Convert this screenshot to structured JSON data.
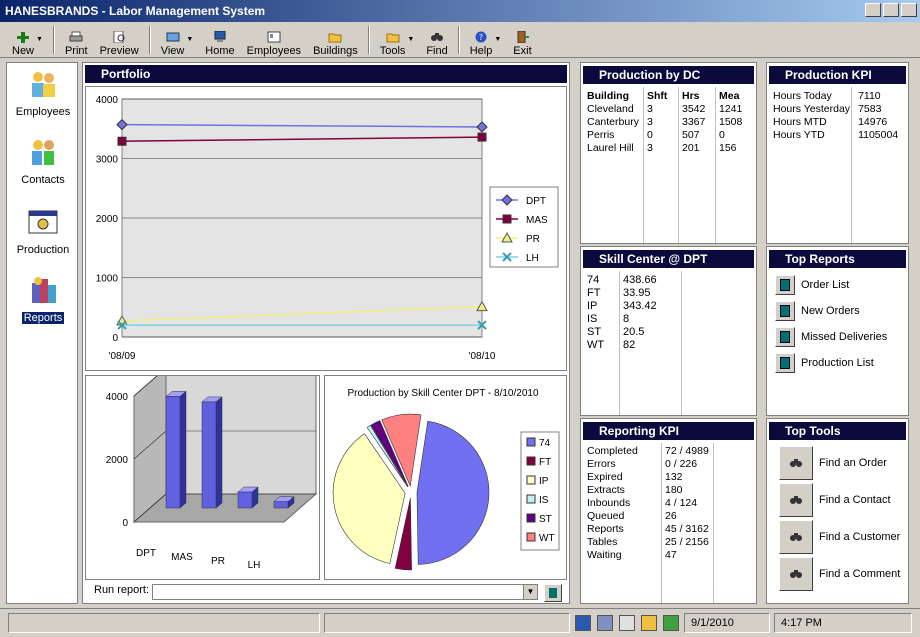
{
  "app": {
    "title": "HANESBRANDS - Labor Management System"
  },
  "toolbar": {
    "new": "New",
    "print": "Print",
    "preview": "Preview",
    "view": "View",
    "home": "Home",
    "employees": "Employees",
    "buildings": "Buildings",
    "tools": "Tools",
    "find": "Find",
    "help": "Help",
    "exit": "Exit"
  },
  "sidebar": {
    "items": [
      {
        "label": "Employees",
        "icon": "people-icon"
      },
      {
        "label": "Contacts",
        "icon": "contacts-icon"
      },
      {
        "label": "Production",
        "icon": "production-icon"
      },
      {
        "label": "Reports",
        "icon": "reports-icon"
      }
    ]
  },
  "portfolio": {
    "title": "Portfolio"
  },
  "chart_data": [
    {
      "type": "line",
      "x": [
        "'08/09",
        "'08/10"
      ],
      "yticks": [
        0,
        1000,
        2000,
        3000,
        4000
      ],
      "ylim": [
        0,
        4000
      ],
      "series": [
        {
          "name": "DPT",
          "values": [
            3570,
            3530
          ],
          "color": "#7070e0"
        },
        {
          "name": "MAS",
          "values": [
            3290,
            3360
          ],
          "color": "#800040"
        },
        {
          "name": "PR",
          "values": [
            270,
            510
          ],
          "color": "#f0f080"
        },
        {
          "name": "LH",
          "values": [
            200,
            200
          ],
          "color": "#80d0e0"
        }
      ],
      "legend": "right"
    },
    {
      "type": "bar",
      "categories": [
        "DPT",
        "MAS",
        "PR",
        "LH"
      ],
      "values": [
        3542,
        3367,
        507,
        201
      ],
      "yticks": [
        0,
        2000,
        4000
      ],
      "ylim": [
        0,
        4000
      ],
      "color": "#6060e0"
    },
    {
      "type": "pie",
      "title": "Production by Skill Center DPT - 8/10/2010",
      "slices": [
        {
          "name": "74",
          "value": 438.66,
          "color": "#7070f0"
        },
        {
          "name": "FT",
          "value": 33.95,
          "color": "#800040"
        },
        {
          "name": "IP",
          "value": 343.42,
          "color": "#ffffc0"
        },
        {
          "name": "IS",
          "value": 8,
          "color": "#c0f0f0"
        },
        {
          "name": "ST",
          "value": 20.5,
          "color": "#600080"
        },
        {
          "name": "WT",
          "value": 82,
          "color": "#ff8080"
        }
      ],
      "legend": "right"
    }
  ],
  "production_dc": {
    "title": "Production by DC",
    "headers": [
      "Building",
      "Shft",
      "Hrs",
      "Mea"
    ],
    "rows": [
      [
        "Cleveland",
        "3",
        "3542",
        "1241"
      ],
      [
        "Canterbury",
        "3",
        "3367",
        "1508"
      ],
      [
        "Perris",
        "0",
        "507",
        "0"
      ],
      [
        "Laurel Hill",
        "3",
        "201",
        "156"
      ]
    ]
  },
  "production_kpi": {
    "title": "Production KPI",
    "rows": [
      [
        "Hours Today",
        "7110"
      ],
      [
        "Hours Yesterday",
        "7583"
      ],
      [
        "Hours MTD",
        "14976"
      ],
      [
        "Hours YTD",
        "1105004"
      ]
    ]
  },
  "skill_center": {
    "title": "Skill Center @ DPT",
    "rows": [
      [
        "74",
        "438.66"
      ],
      [
        "FT",
        "33.95"
      ],
      [
        "IP",
        "343.42"
      ],
      [
        "IS",
        "8"
      ],
      [
        "ST",
        "20.5"
      ],
      [
        "WT",
        "82"
      ]
    ]
  },
  "top_reports": {
    "title": "Top Reports",
    "items": [
      "Order List",
      "New Orders",
      "Missed Deliveries",
      "Production List"
    ]
  },
  "reporting_kpi": {
    "title": "Reporting KPI",
    "rows": [
      [
        "Completed",
        "72 / 4989"
      ],
      [
        "Errors",
        "0 / 226"
      ],
      [
        "Expired",
        "132"
      ],
      [
        "Extracts",
        "180"
      ],
      [
        "Inbounds",
        "4 / 124"
      ],
      [
        "Queued",
        "26"
      ],
      [
        "Reports",
        "45 / 3162"
      ],
      [
        "Tables",
        "25 / 2156"
      ],
      [
        "Waiting",
        "47"
      ]
    ]
  },
  "top_tools": {
    "title": "Top Tools",
    "items": [
      "Find an Order",
      "Find a Contact",
      "Find a Customer",
      "Find a Comment"
    ]
  },
  "run_report": {
    "label": "Run report:",
    "value": ""
  },
  "status": {
    "date": "9/1/2010",
    "time": "4:17 PM"
  }
}
